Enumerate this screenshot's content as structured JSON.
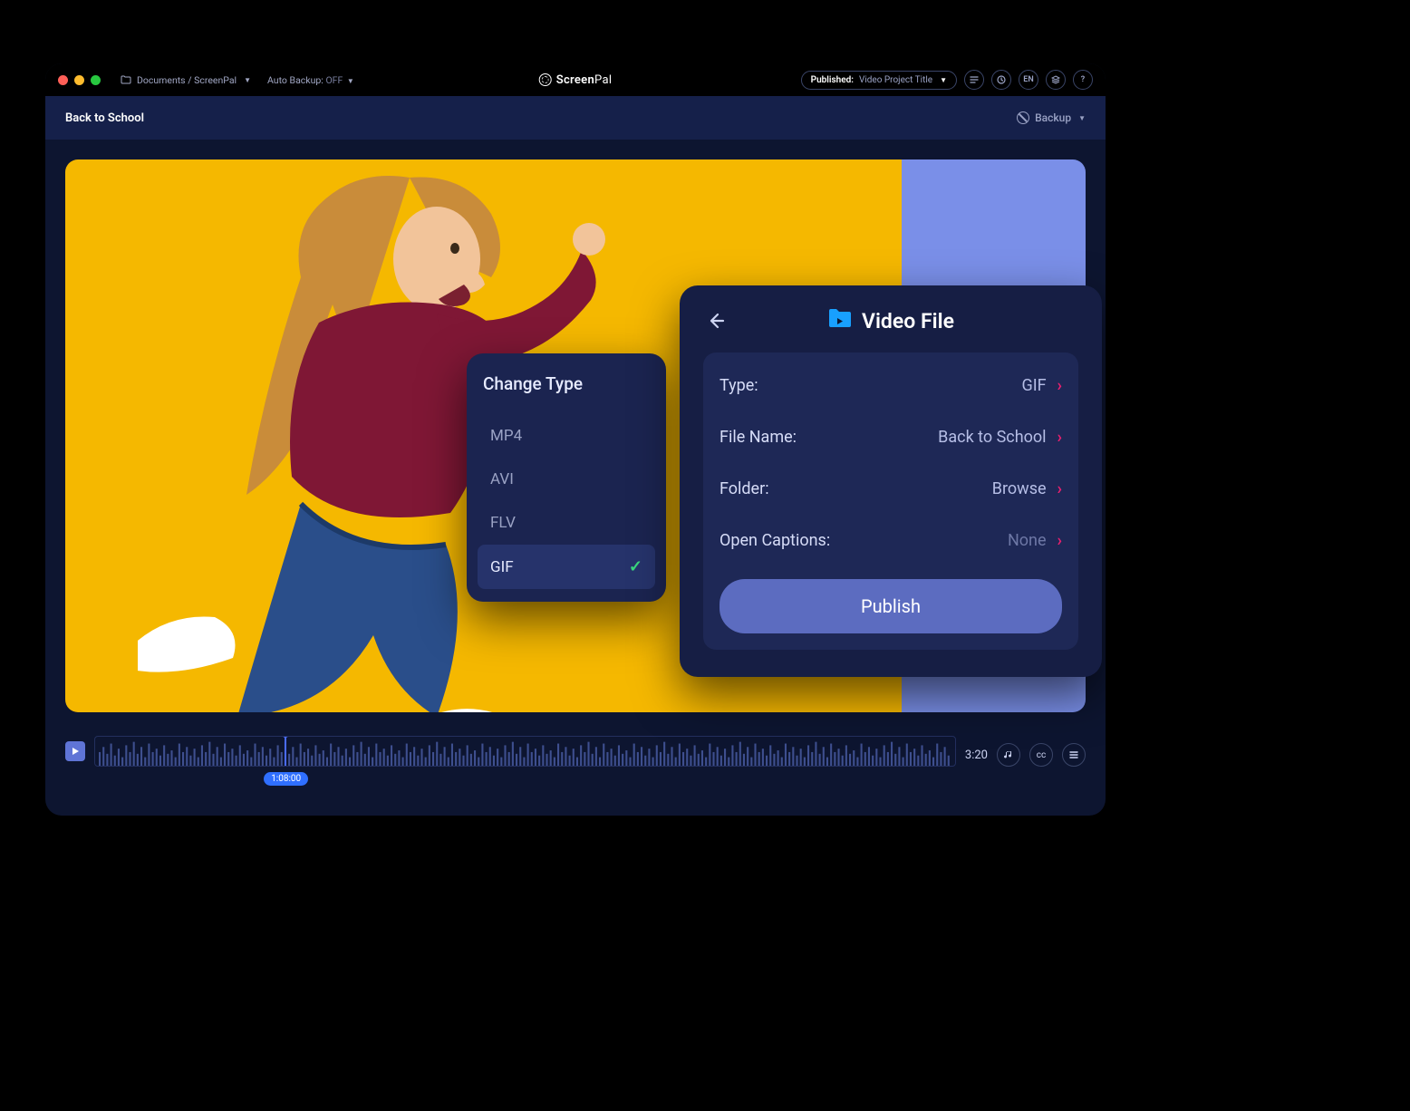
{
  "titlebar": {
    "breadcrumb": "Documents / ScreenPal",
    "auto_backup_label": "Auto Backup:",
    "auto_backup_value": "OFF",
    "brand_first": "Screen",
    "brand_second": "Pal",
    "published_label": "Published:",
    "published_value": "Video Project Title",
    "lang": "EN"
  },
  "projectbar": {
    "title": "Back to School",
    "backup_label": "Backup"
  },
  "timeline": {
    "duration": "3:20",
    "playhead_time": "1:08:00",
    "cc_label": "cc"
  },
  "change_type": {
    "title": "Change Type",
    "options": [
      {
        "label": "MP4",
        "selected": false
      },
      {
        "label": "AVI",
        "selected": false
      },
      {
        "label": "FLV",
        "selected": false
      },
      {
        "label": "GIF",
        "selected": true
      }
    ]
  },
  "video_file": {
    "title": "Video File",
    "rows": {
      "type_label": "Type:",
      "type_value": "GIF",
      "filename_label": "File Name:",
      "filename_value": "Back to School",
      "folder_label": "Folder:",
      "folder_value": "Browse",
      "captions_label": "Open Captions:",
      "captions_value": "None"
    },
    "publish_label": "Publish"
  }
}
